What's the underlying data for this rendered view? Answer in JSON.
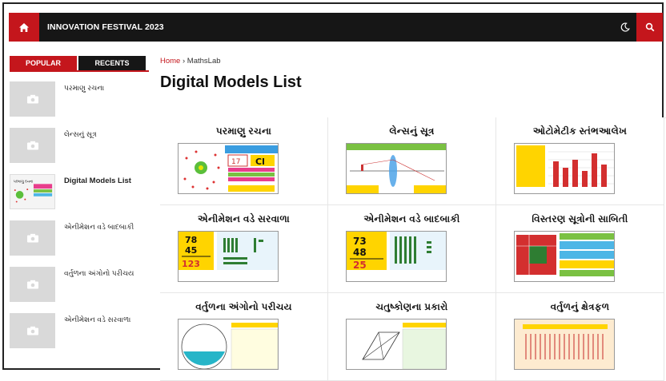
{
  "header": {
    "site_title": "INNOVATION FESTIVAL 2023",
    "icons": [
      "home-icon",
      "moon-icon",
      "search-icon"
    ],
    "accent_color": "#c4161c",
    "bar_color": "#161616"
  },
  "sidebar": {
    "tabs": [
      {
        "label": "POPULAR",
        "active": true
      },
      {
        "label": "RECENTS",
        "active": false
      }
    ],
    "items": [
      {
        "title": "પરમાણુ રચના"
      },
      {
        "title": "લેન્સનું સૂત્ર"
      },
      {
        "title": "Digital Models List",
        "thumb_label": "પરમાણુ રચના"
      },
      {
        "title": "એનીમેશન વડે બાદબાકી"
      },
      {
        "title": "વર્તુળના અંગોનો પરીચય"
      },
      {
        "title": "એનીમેશન વડે સરવાળા"
      }
    ]
  },
  "main": {
    "breadcrumb": {
      "home": "Home",
      "separator": "›",
      "current": "MathsLab"
    },
    "title": "Digital Models List",
    "cards": [
      {
        "title": "પરમાણુ રચના",
        "label": "Cl",
        "value": "17"
      },
      {
        "title": "લેન્સનું સૂત્ર"
      },
      {
        "title": "ઓટોમેટીક સ્તંભઆલેખ"
      },
      {
        "title": "એનીમેશન વડે સરવાળા",
        "top_number": "78",
        "second_number": "45",
        "result": "123"
      },
      {
        "title": "એનીમેશન વડે બાદબાકી",
        "top_number": "73",
        "second_number": "48",
        "result": "25"
      },
      {
        "title": "વિસ્તરણ સૂત્રોની સાબિતી"
      },
      {
        "title": "વર્તુળના અંગોનો પરીચય"
      },
      {
        "title": "ચતુષ્કોણના પ્રકારો"
      },
      {
        "title": "વર્તુળનું ક્ષેત્રફળ"
      }
    ]
  }
}
